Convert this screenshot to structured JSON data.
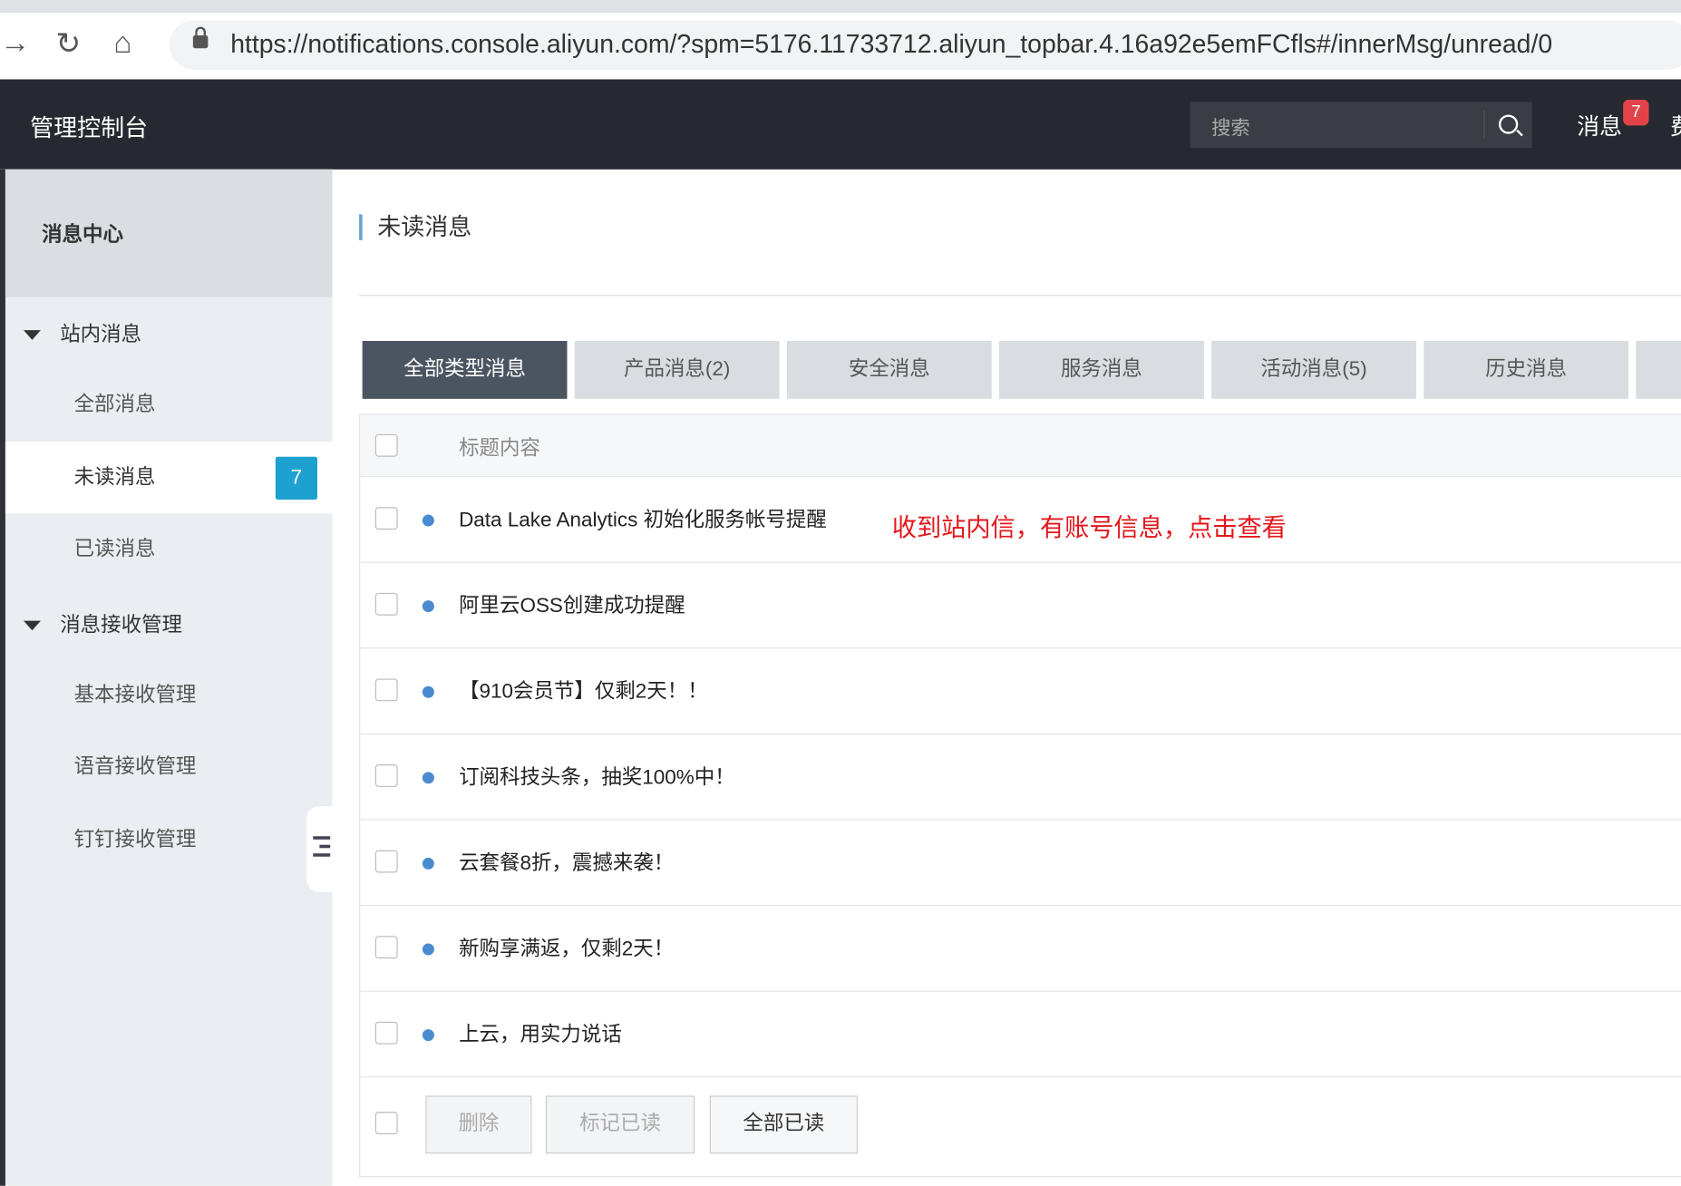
{
  "browser": {
    "url": "https://notifications.console.aliyun.com/?spm=5176.11733712.aliyun_topbar.4.16a92e5emFCfls#/innerMsg/unread/0"
  },
  "topbar": {
    "brand": "管理控制台",
    "search_placeholder": "搜索",
    "messages_label": "消息",
    "messages_count": "7",
    "next_label": "费"
  },
  "sidebar": {
    "title": "消息中心",
    "groups": [
      {
        "label": "站内消息",
        "items": [
          {
            "label": "全部消息"
          },
          {
            "label": "未读消息",
            "badge": "7",
            "active": true
          },
          {
            "label": "已读消息"
          }
        ]
      },
      {
        "label": "消息接收管理",
        "items": [
          {
            "label": "基本接收管理"
          },
          {
            "label": "语音接收管理"
          },
          {
            "label": "钉钉接收管理"
          }
        ]
      }
    ]
  },
  "main": {
    "title": "未读消息",
    "tabs": [
      {
        "label": "全部类型消息",
        "active": true
      },
      {
        "label": "产品消息(2)"
      },
      {
        "label": "安全消息"
      },
      {
        "label": "服务消息"
      },
      {
        "label": "活动消息(5)"
      },
      {
        "label": "历史消息"
      }
    ],
    "table": {
      "header": "标题内容",
      "rows": [
        {
          "title": "Data Lake Analytics 初始化服务帐号提醒"
        },
        {
          "title": "阿里云OSS创建成功提醒"
        },
        {
          "title": "【910会员节】仅剩2天！！"
        },
        {
          "title": "订阅科技头条，抽奖100%中！"
        },
        {
          "title": "云套餐8折，震撼来袭！"
        },
        {
          "title": "新购享满返，仅剩2天！"
        },
        {
          "title": "上云，用实力说话"
        }
      ]
    },
    "annotation": "收到站内信，有账号信息，点击查看",
    "actions": {
      "delete": "删除",
      "mark_read": "标记已读",
      "mark_all_read": "全部已读"
    }
  },
  "colors": {
    "topbar": "#262a30",
    "active_tab": "#4b5561",
    "badge": "#1ea0d0",
    "annotation": "#e3161b",
    "unread_dot": "#4a8bd0"
  }
}
